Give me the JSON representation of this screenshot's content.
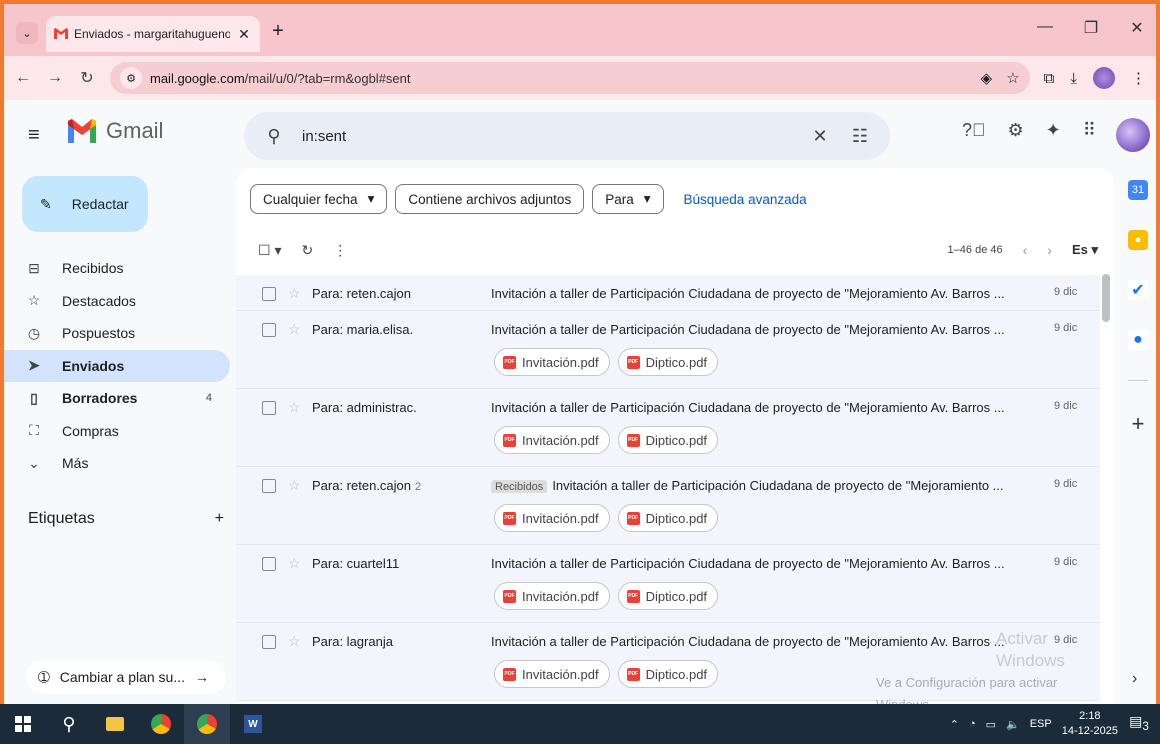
{
  "browser": {
    "tab_title": "Enviados - margaritahugueno@",
    "tab_close": "✕",
    "new_tab": "+",
    "url_domain": "mail.google.com",
    "url_path": "/mail/u/0/?tab=rm&ogbl#sent"
  },
  "gmail": {
    "app_name": "Gmail",
    "search_value": "in:sent",
    "compose_label": "Redactar"
  },
  "sidebar": {
    "items": [
      {
        "label": "Recibidos",
        "icon": "inbox-icon",
        "glyph": "⊟",
        "count": ""
      },
      {
        "label": "Destacados",
        "icon": "star-icon",
        "glyph": "☆",
        "count": ""
      },
      {
        "label": "Pospuestos",
        "icon": "clock-icon",
        "glyph": "◷",
        "count": ""
      },
      {
        "label": "Enviados",
        "icon": "send-icon",
        "glyph": "➤",
        "count": ""
      },
      {
        "label": "Borradores",
        "icon": "draft-icon",
        "glyph": "▯",
        "count": "4"
      },
      {
        "label": "Compras",
        "icon": "bag-icon",
        "glyph": "⛶",
        "count": ""
      },
      {
        "label": "Más",
        "icon": "chevron-down-icon",
        "glyph": "⌄",
        "count": ""
      }
    ],
    "labels_title": "Etiquetas",
    "labels_add": "+",
    "plan_label": "Cambiar a plan su..."
  },
  "filters": {
    "date": "Cualquier fecha",
    "attachments": "Contiene archivos adjuntos",
    "to": "Para",
    "advanced": "Búsqueda avanzada"
  },
  "list": {
    "pagination": "1–46 de 46",
    "lang": "Es"
  },
  "emails": [
    {
      "sender": "Para: reten.cajon",
      "thread": "",
      "tag": "",
      "subject": "Invitación a taller de Participación Ciudadana de proyecto de \"Mejoramiento Av. Barros ...",
      "date": "9 dic",
      "attachments": []
    },
    {
      "sender": "Para: maria.elisa.",
      "thread": "",
      "tag": "",
      "subject": "Invitación a taller de Participación Ciudadana de proyecto de \"Mejoramiento Av. Barros ...",
      "date": "9 dic",
      "attachments": [
        "Invitación.pdf",
        "Diptico.pdf"
      ]
    },
    {
      "sender": "Para: administrac.",
      "thread": "",
      "tag": "",
      "subject": "Invitación a taller de Participación Ciudadana de proyecto de \"Mejoramiento Av. Barros ...",
      "date": "9 dic",
      "attachments": [
        "Invitación.pdf",
        "Diptico.pdf"
      ]
    },
    {
      "sender": "Para: reten.cajon",
      "thread": "2",
      "tag": "Recibidos",
      "subject": "Invitación a taller de Participación Ciudadana de proyecto de \"Mejoramiento ...",
      "date": "9 dic",
      "attachments": [
        "Invitación.pdf",
        "Diptico.pdf"
      ]
    },
    {
      "sender": "Para: cuartel11",
      "thread": "",
      "tag": "",
      "subject": "Invitación a taller de Participación Ciudadana de proyecto de \"Mejoramiento Av. Barros ...",
      "date": "9 dic",
      "attachments": [
        "Invitación.pdf",
        "Diptico.pdf"
      ]
    },
    {
      "sender": "Para: lagranja",
      "thread": "",
      "tag": "",
      "subject": "Invitación a taller de Participación Ciudadana de proyecto de \"Mejoramiento Av. Barros ...",
      "date": "9 dic",
      "attachments": [
        "Invitación.pdf",
        "Diptico.pdf"
      ]
    }
  ],
  "watermark": {
    "line1": "Activar Windows",
    "line2": "Ve a Configuración para activar Windows."
  },
  "taskbar": {
    "lang": "ESP",
    "time": "2:18",
    "date": "14-12-2025",
    "notifications": "3"
  },
  "colors": {
    "accent": "#0b57d0",
    "compose_bg": "#c2e7ff",
    "active_nav": "#d3e3fd",
    "frame": "#f07a2e",
    "pdf": "#e94235"
  }
}
